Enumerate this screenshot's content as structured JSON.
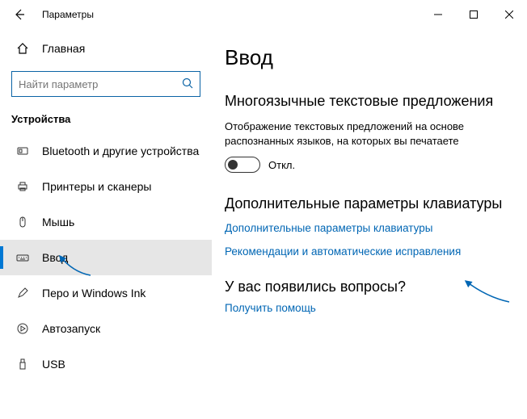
{
  "titlebar": {
    "title": "Параметры"
  },
  "sidebar": {
    "home": "Главная",
    "search_placeholder": "Найти параметр",
    "section": "Устройства",
    "items": [
      {
        "label": "Bluetooth и другие устройства"
      },
      {
        "label": "Принтеры и сканеры"
      },
      {
        "label": "Мышь"
      },
      {
        "label": "Ввод"
      },
      {
        "label": "Перо и Windows Ink"
      },
      {
        "label": "Автозапуск"
      },
      {
        "label": "USB"
      }
    ]
  },
  "content": {
    "page_title": "Ввод",
    "section1_heading": "Многоязычные текстовые предложения",
    "section1_desc": "Отображение текстовых предложений на основе распознанных языков, на которых вы печатаете",
    "toggle_label": "Откл.",
    "section2_heading": "Дополнительные параметры клавиатуры",
    "link1": "Дополнительные параметры клавиатуры",
    "link2": "Рекомендации и автоматические исправления",
    "help_heading": "У вас появились вопросы?",
    "help_link": "Получить помощь"
  }
}
